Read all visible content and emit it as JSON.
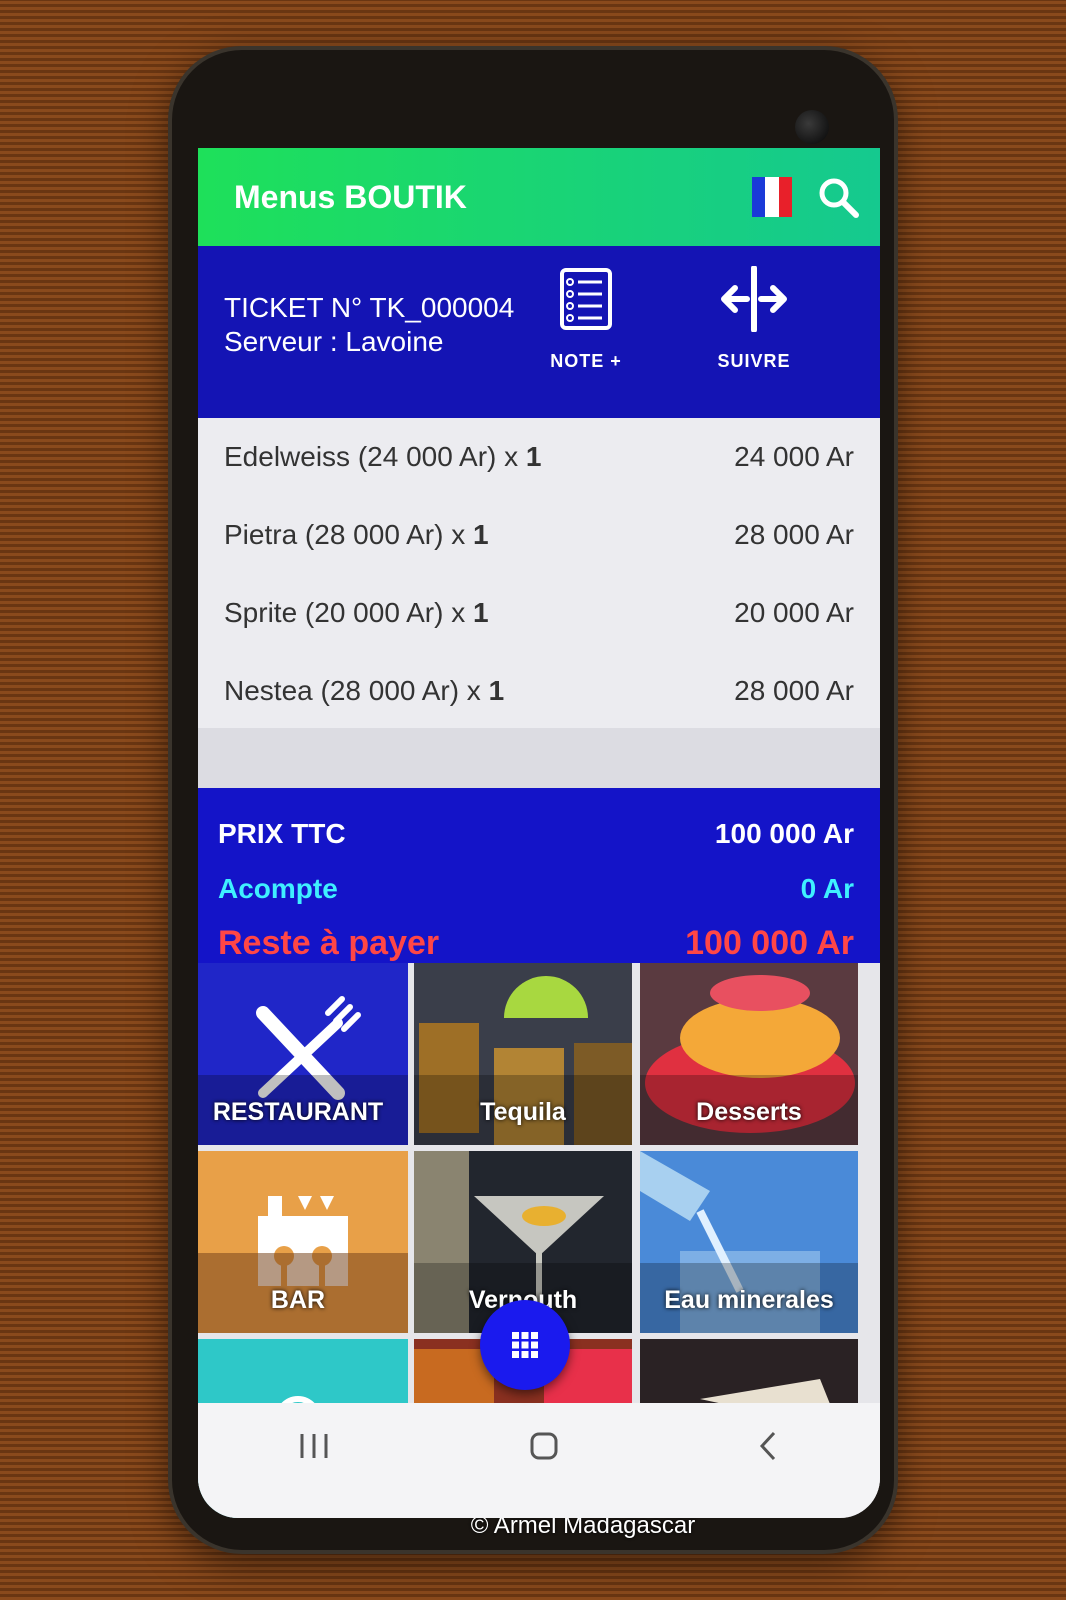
{
  "appbar": {
    "title": "Menus BOUTIK",
    "flag_icon": "flag-fr-icon",
    "search_icon": "search-icon"
  },
  "ticket": {
    "number": "TICKET N° TK_000004",
    "server": "Serveur : Lavoine",
    "note_button": "NOTE +",
    "follow_button": "SUIVRE"
  },
  "items": [
    {
      "name": "Edelweiss (24 000 Ar) x ",
      "qty": "1",
      "total": "24 000 Ar"
    },
    {
      "name": "Pietra (28 000 Ar) x ",
      "qty": "1",
      "total": "28 000 Ar"
    },
    {
      "name": "Sprite (20 000 Ar) x ",
      "qty": "1",
      "total": "20 000 Ar"
    },
    {
      "name": "Nestea (28 000 Ar) x ",
      "qty": "1",
      "total": "28 000 Ar"
    }
  ],
  "totals": {
    "prix_label": "PRIX TTC",
    "prix_value": "100 000 Ar",
    "acompte_label": "Acompte",
    "acompte_value": "0 Ar",
    "reste_label": "Reste à payer",
    "reste_value": "100 000 Ar"
  },
  "categories": [
    {
      "label": "RESTAURANT",
      "icon": "fork-knife-icon"
    },
    {
      "label": "Tequila"
    },
    {
      "label": "Desserts"
    },
    {
      "label": "BAR",
      "icon": "bar-counter-icon"
    },
    {
      "label": "Vernouth"
    },
    {
      "label": "Eau minerales"
    }
  ],
  "fab_icon": "grid-menu-icon",
  "navbar": {
    "recent_icon": "recent-apps-icon",
    "home_icon": "home-icon",
    "back_icon": "back-icon"
  },
  "watermark": "© Armel Madagascar",
  "colors": {
    "appbar": "#1ee05a",
    "header": "#1414b4",
    "totals": "#1414c8",
    "acompte": "#3ff0ff",
    "reste": "#ff4646"
  }
}
